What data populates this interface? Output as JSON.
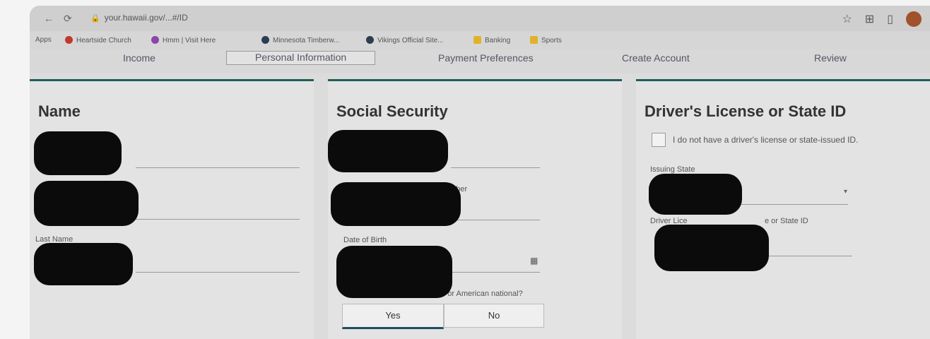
{
  "browser": {
    "url": "your.hawaii.gov/...#/ID",
    "bookmarks": [
      {
        "label": "Apps",
        "color": ""
      },
      {
        "label": "Heartside Church",
        "color": "#c0392b"
      },
      {
        "label": "Hmm | Visit Here",
        "color": "#8e44ad"
      },
      {
        "label": "Minnesota Timberw...",
        "color": "#2c3e50"
      },
      {
        "label": "Vikings Official Site...",
        "color": "#2c3e50"
      },
      {
        "label": "Banking",
        "color": "#e1b12c"
      },
      {
        "label": "Sports",
        "color": "#e1b12c"
      }
    ]
  },
  "steps": [
    {
      "label": "Income"
    },
    {
      "label": "Personal Information"
    },
    {
      "label": "Payment Preferences"
    },
    {
      "label": "Create Account"
    },
    {
      "label": "Review"
    }
  ],
  "name_section": {
    "title": "Name",
    "last_name_label": "Last Name"
  },
  "ssn_section": {
    "title": "Social Security",
    "ssn_partial_label": "umber",
    "dob_label": "Date of Birth",
    "citizen_question": "you a United States citizen or American national?",
    "yes_label": "Yes",
    "no_label": "No"
  },
  "license_section": {
    "title": "Driver's License or State ID",
    "no_license_checkbox_label": "I do not have a driver's license or state-issued ID.",
    "issuing_state_label": "Issuing State",
    "number_label_start": "Driver Lice",
    "number_label_end": "e or State ID"
  },
  "colors": {
    "accent": "#1f5f5a"
  }
}
